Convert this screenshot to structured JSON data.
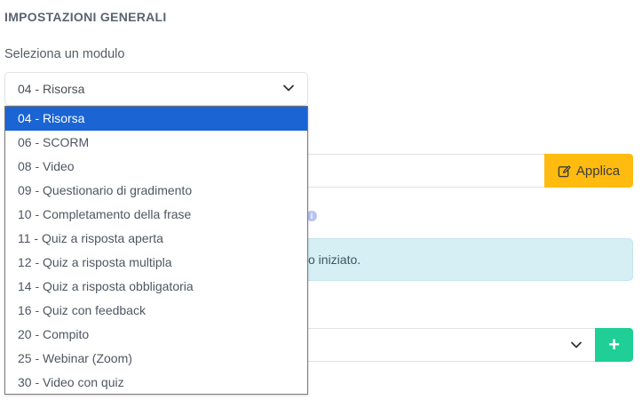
{
  "section": {
    "title": "IMPOSTAZIONI GENERALI"
  },
  "module_select": {
    "label": "Seleziona un modulo",
    "value": "04 - Risorsa",
    "options": [
      "04 - Risorsa",
      "06 - SCORM",
      "08 - Video",
      "09 - Questionario di gradimento",
      "10 - Completamento della frase",
      "11 - Quiz a risposta aperta",
      "12 - Quiz a risposta multipla",
      "14 - Quiz a risposta obbligatoria",
      "16 - Quiz con feedback",
      "20 - Compito",
      "25 - Webinar (Zoom)",
      "30 - Video con quiz"
    ],
    "highlighted_index": 0
  },
  "apply": {
    "label": "Applica",
    "icon": "edit-icon"
  },
  "alert": {
    "text": "o iniziato."
  },
  "info": {
    "icon": "info-icon"
  },
  "add": {
    "label": "+",
    "icon": "plus-icon"
  },
  "colors": {
    "apply_bg": "#ffbb0f",
    "add_bg": "#1fcf95",
    "alert_bg": "#d6eff5",
    "highlight": "#1a64d3"
  }
}
